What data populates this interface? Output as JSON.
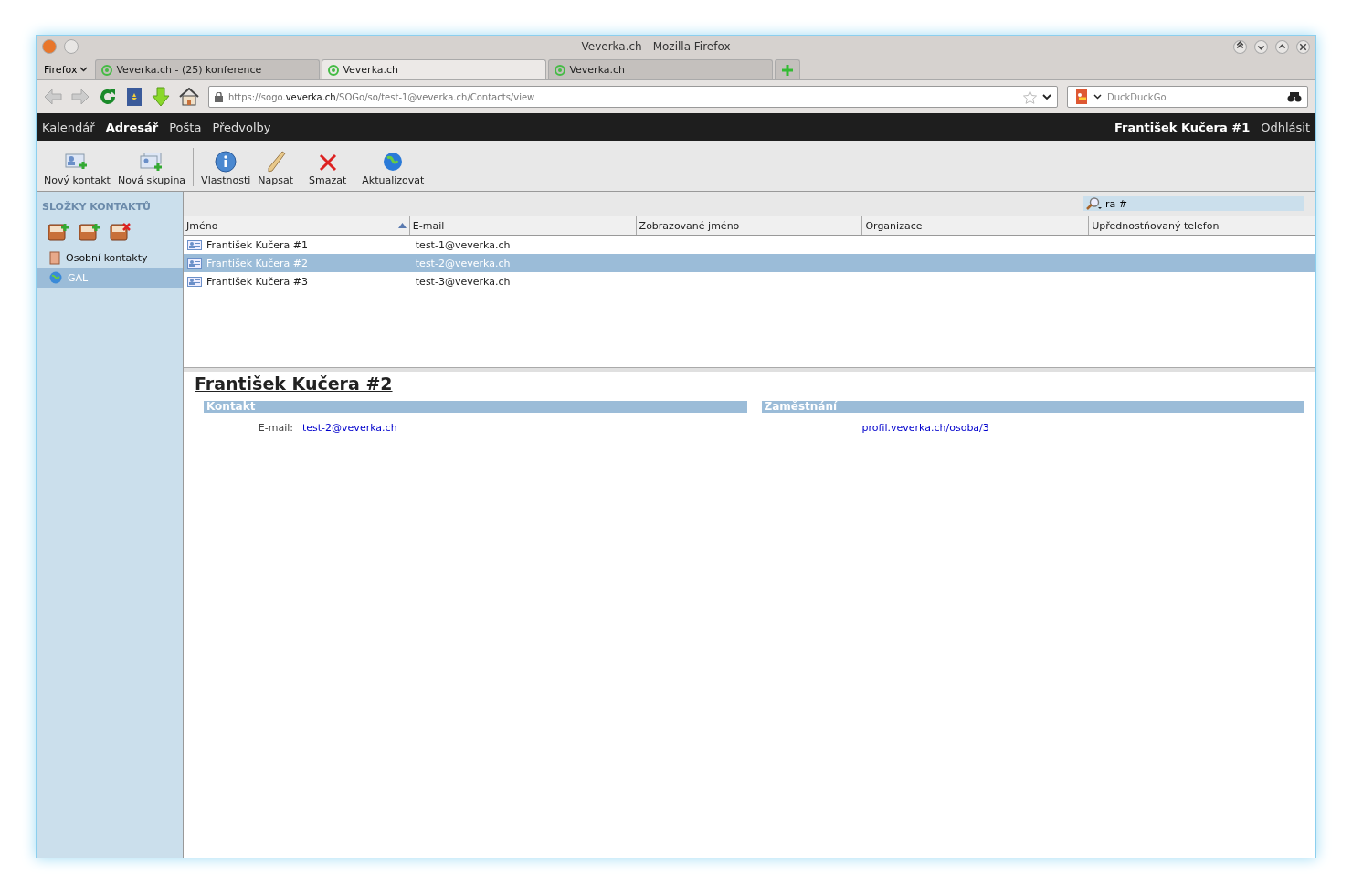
{
  "window": {
    "title": "Veverka.ch - Mozilla Firefox"
  },
  "browser": {
    "menu_label": "Firefox",
    "tabs": [
      {
        "label": "Veverka.ch - (25) konference",
        "selected": false
      },
      {
        "label": "Veverka.ch",
        "selected": true
      },
      {
        "label": "Veverka.ch",
        "selected": false
      }
    ],
    "url": {
      "prefix": "https://sogo.",
      "domain": "veverka.ch",
      "path": "/SOGo/so/test-1@veverka.ch/Contacts/view"
    },
    "search": {
      "placeholder": "DuckDuckGo"
    }
  },
  "app_menu": {
    "items": [
      {
        "label": "Kalendář",
        "selected": false
      },
      {
        "label": "Adresář",
        "selected": true
      },
      {
        "label": "Pošta",
        "selected": false
      },
      {
        "label": "Předvolby",
        "selected": false
      }
    ],
    "user": "František Kučera #1",
    "logout": "Odhlásit"
  },
  "toolbar": [
    {
      "label": "Nový kontakt",
      "kind": "new-contact"
    },
    {
      "label": "Nová skupina",
      "kind": "new-group"
    },
    {
      "kind": "sep"
    },
    {
      "label": "Vlastnosti",
      "kind": "info"
    },
    {
      "label": "Napsat",
      "kind": "pencil"
    },
    {
      "kind": "sep"
    },
    {
      "label": "Smazat",
      "kind": "delete"
    },
    {
      "kind": "sep"
    },
    {
      "label": "Aktualizovat",
      "kind": "refresh"
    }
  ],
  "sidebar": {
    "title": "SLOŽKY KONTAKTŮ",
    "items": [
      {
        "label": "Osobní kontakty",
        "kind": "book",
        "selected": false
      },
      {
        "label": "GAL",
        "kind": "globe",
        "selected": true
      }
    ]
  },
  "search": {
    "value": "ra #"
  },
  "table": {
    "columns": [
      "Jméno",
      "E-mail",
      "Zobrazované jméno",
      "Organizace",
      "Upřednostňovaný telefon"
    ],
    "rows": [
      {
        "name": "František Kučera #1",
        "email": "test-1@veverka.ch",
        "selected": false
      },
      {
        "name": "František Kučera #2",
        "email": "test-2@veverka.ch",
        "selected": true
      },
      {
        "name": "František Kučera #3",
        "email": "test-3@veverka.ch",
        "selected": false
      }
    ]
  },
  "detail": {
    "title": "František Kučera #2",
    "contact": {
      "heading": "Kontakt",
      "label": "E-mail:",
      "value": "test-2@veverka.ch"
    },
    "work": {
      "heading": "Zaměstnání",
      "link": "profil.veverka.ch/osoba/3"
    }
  }
}
